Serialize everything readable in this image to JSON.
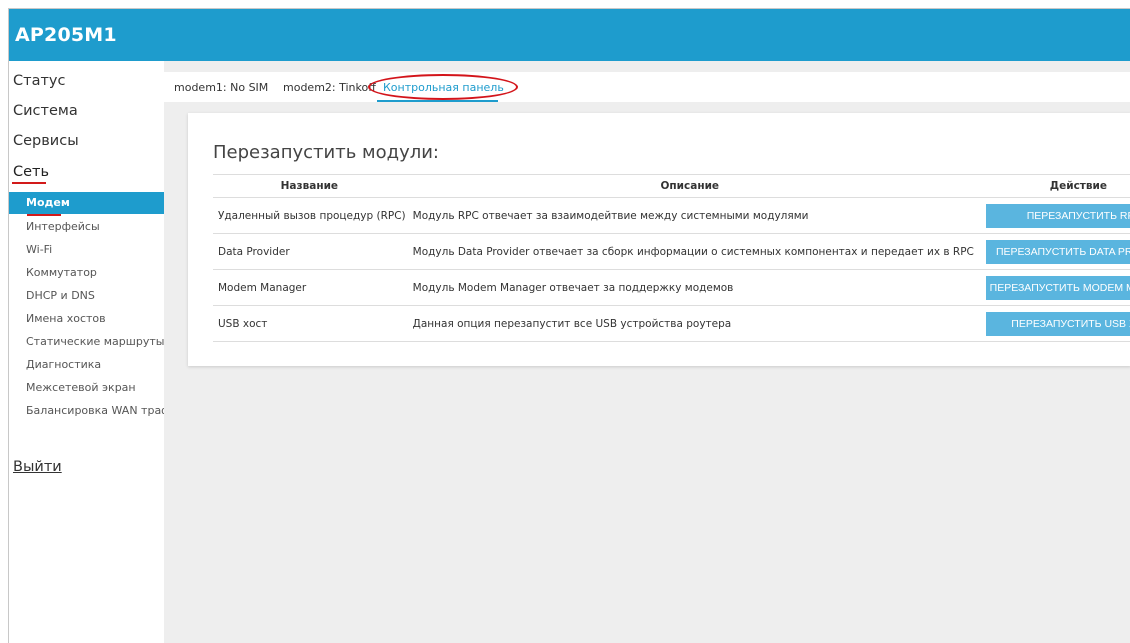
{
  "app": {
    "title": "AP205M1"
  },
  "sidebar": {
    "main_items": [
      "Статус",
      "Система",
      "Сервисы",
      "Сеть"
    ],
    "sub_items": [
      "Модем",
      "Интерфейсы",
      "Wi-Fi",
      "Коммутатор",
      "DHCP и DNS",
      "Имена хостов",
      "Статические маршруты",
      "Диагностика",
      "Межсетевой экран",
      "Балансировка WAN трафик"
    ],
    "logout": "Выйти"
  },
  "tabs": [
    "modem1: No SIM",
    "modem2: Tinkoff",
    "Контрольная панель"
  ],
  "panel": {
    "title": "Перезапустить модули:",
    "columns": [
      "Название",
      "Описание",
      "Действие"
    ],
    "rows": [
      {
        "name": "Удаленный вызов процедур (RPC)",
        "description": "Модуль RPC отвечает за взаимодейтвие между системными модулями",
        "action": "ПЕРЕЗАПУСТИТЬ RPC"
      },
      {
        "name": "Data Provider",
        "description": "Модуль Data Provider отвечает за сборк информации о системных компонентах и передает их в RPC",
        "action": "ПЕРЕЗАПУСТИТЬ DATA PROVIDER"
      },
      {
        "name": "Modem Manager",
        "description": "Модуль Modem Manager отвечает за поддержку модемов",
        "action": "ПЕРЕЗАПУСТИТЬ MODEM MANAGER"
      },
      {
        "name": "USB хост",
        "description": "Данная опция перезапустит все USB устройства роутера",
        "action": "ПЕРЕЗАПУСТИТЬ USB ХОСТ"
      }
    ]
  },
  "colors": {
    "accent": "#1e9ccd",
    "button": "#5ab5df",
    "highlight": "#d3141a"
  }
}
